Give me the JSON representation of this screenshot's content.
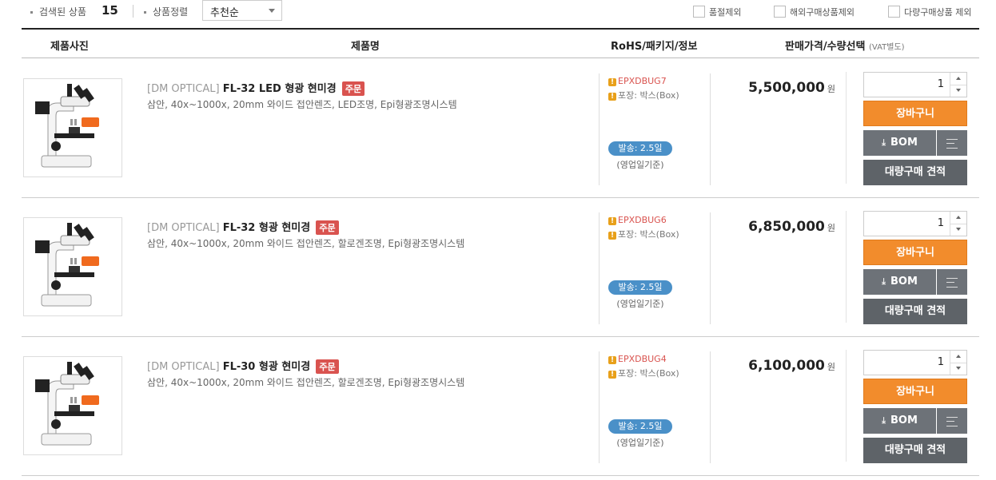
{
  "filter": {
    "searched_label": "검색된 상품",
    "searched_count": "15",
    "sort_label": "상품정렬",
    "sort_selected": "추천순",
    "exclude_soldout": "품절제외",
    "exclude_overseas": "해외구매상품제외",
    "exclude_bulk": "다량구매상품 제외"
  },
  "table": {
    "col_photo": "제품사진",
    "col_name": "제품명",
    "col_info": "RoHS/패키지/정보",
    "col_price": "판매가격/수량선택",
    "col_price_note": "(VAT별도)"
  },
  "labels": {
    "order_badge": "주문",
    "won": "원",
    "cart": "장바구니",
    "bom": "BOM",
    "bulk": "대량구매 견적",
    "ship_note": "(영업일기준)"
  },
  "products": [
    {
      "brand": "[DM OPTICAL]",
      "model": "FL-32 LED 형광 현미경",
      "desc": "삼안, 40x~1000x, 20mm 와이드 접안렌즈, LED조명, Epi형광조명시스템",
      "code": "EPXDBUG7",
      "pack": "포장: 박스(Box)",
      "ship": "발송: 2.5일",
      "price": "5,500,000",
      "qty": "1"
    },
    {
      "brand": "[DM OPTICAL]",
      "model": "FL-32 형광 현미경",
      "desc": "삼안, 40x~1000x, 20mm 와이드 접안렌즈, 할로겐조명, Epi형광조명시스템",
      "code": "EPXDBUG6",
      "pack": "포장: 박스(Box)",
      "ship": "발송: 2.5일",
      "price": "6,850,000",
      "qty": "1"
    },
    {
      "brand": "[DM OPTICAL]",
      "model": "FL-30 형광 현미경",
      "desc": "삼안, 40x~1000x, 20mm 와이드 접안렌즈, 할로겐조명, Epi형광조명시스템",
      "code": "EPXDBUG4",
      "pack": "포장: 박스(Box)",
      "ship": "발송: 2.5일",
      "price": "6,100,000",
      "qty": "1"
    }
  ]
}
